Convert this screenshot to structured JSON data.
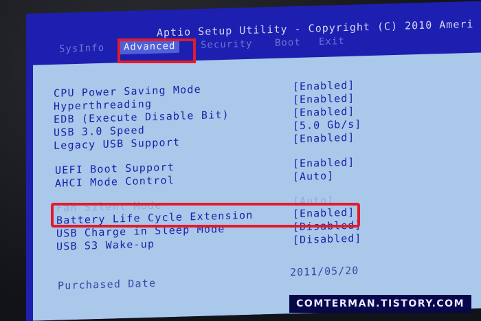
{
  "header": {
    "title": "Aptio Setup Utility - Copyright (C) 2010 Ameri"
  },
  "tabs": [
    {
      "label": "SysInfo"
    },
    {
      "label": "Advanced"
    },
    {
      "label": "Security"
    },
    {
      "label": "Boot"
    },
    {
      "label": "Exit"
    }
  ],
  "settings": [
    {
      "label": "CPU Power Saving Mode",
      "value": "[Enabled]"
    },
    {
      "label": "Hyperthreading",
      "value": "[Enabled]"
    },
    {
      "label": "EDB (Execute Disable Bit)",
      "value": "[Enabled]"
    },
    {
      "label": "USB 3.0 Speed",
      "value": "[5.0 Gb/s]"
    },
    {
      "label": "Legacy USB Support",
      "value": "[Enabled]"
    },
    {
      "label": "UEFI Boot Support",
      "value": "[Enabled]"
    },
    {
      "label": "AHCI Mode Control",
      "value": "[Auto]"
    },
    {
      "label": "Fan Silent Mode",
      "value": "[Auto]"
    },
    {
      "label": "Battery Life Cycle Extension",
      "value": "[Enabled]"
    },
    {
      "label": "USB Charge in Sleep Mode",
      "value": "[Disabled]"
    },
    {
      "label": "USB S3 Wake-up",
      "value": "[Disabled]"
    },
    {
      "label": "Purchased Date",
      "value": "2011/05/20"
    }
  ],
  "watermark": "COMTERMAN.TISTORY.COM",
  "colors": {
    "panel": "#a9c8ea",
    "text": "#1d20a6",
    "header": "#1d1fb0",
    "highlight": "#e11b2a"
  }
}
